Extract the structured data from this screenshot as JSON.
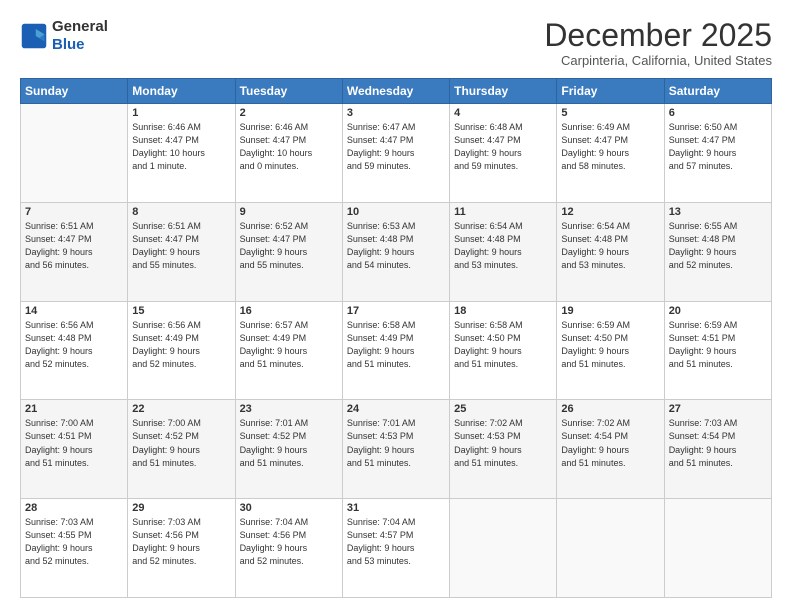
{
  "header": {
    "logo_line1": "General",
    "logo_line2": "Blue",
    "month": "December 2025",
    "location": "Carpinteria, California, United States"
  },
  "weekdays": [
    "Sunday",
    "Monday",
    "Tuesday",
    "Wednesday",
    "Thursday",
    "Friday",
    "Saturday"
  ],
  "weeks": [
    [
      {
        "day": "",
        "info": ""
      },
      {
        "day": "1",
        "info": "Sunrise: 6:46 AM\nSunset: 4:47 PM\nDaylight: 10 hours\nand 1 minute."
      },
      {
        "day": "2",
        "info": "Sunrise: 6:46 AM\nSunset: 4:47 PM\nDaylight: 10 hours\nand 0 minutes."
      },
      {
        "day": "3",
        "info": "Sunrise: 6:47 AM\nSunset: 4:47 PM\nDaylight: 9 hours\nand 59 minutes."
      },
      {
        "day": "4",
        "info": "Sunrise: 6:48 AM\nSunset: 4:47 PM\nDaylight: 9 hours\nand 59 minutes."
      },
      {
        "day": "5",
        "info": "Sunrise: 6:49 AM\nSunset: 4:47 PM\nDaylight: 9 hours\nand 58 minutes."
      },
      {
        "day": "6",
        "info": "Sunrise: 6:50 AM\nSunset: 4:47 PM\nDaylight: 9 hours\nand 57 minutes."
      }
    ],
    [
      {
        "day": "7",
        "info": "Sunrise: 6:51 AM\nSunset: 4:47 PM\nDaylight: 9 hours\nand 56 minutes."
      },
      {
        "day": "8",
        "info": "Sunrise: 6:51 AM\nSunset: 4:47 PM\nDaylight: 9 hours\nand 55 minutes."
      },
      {
        "day": "9",
        "info": "Sunrise: 6:52 AM\nSunset: 4:47 PM\nDaylight: 9 hours\nand 55 minutes."
      },
      {
        "day": "10",
        "info": "Sunrise: 6:53 AM\nSunset: 4:48 PM\nDaylight: 9 hours\nand 54 minutes."
      },
      {
        "day": "11",
        "info": "Sunrise: 6:54 AM\nSunset: 4:48 PM\nDaylight: 9 hours\nand 53 minutes."
      },
      {
        "day": "12",
        "info": "Sunrise: 6:54 AM\nSunset: 4:48 PM\nDaylight: 9 hours\nand 53 minutes."
      },
      {
        "day": "13",
        "info": "Sunrise: 6:55 AM\nSunset: 4:48 PM\nDaylight: 9 hours\nand 52 minutes."
      }
    ],
    [
      {
        "day": "14",
        "info": "Sunrise: 6:56 AM\nSunset: 4:48 PM\nDaylight: 9 hours\nand 52 minutes."
      },
      {
        "day": "15",
        "info": "Sunrise: 6:56 AM\nSunset: 4:49 PM\nDaylight: 9 hours\nand 52 minutes."
      },
      {
        "day": "16",
        "info": "Sunrise: 6:57 AM\nSunset: 4:49 PM\nDaylight: 9 hours\nand 51 minutes."
      },
      {
        "day": "17",
        "info": "Sunrise: 6:58 AM\nSunset: 4:49 PM\nDaylight: 9 hours\nand 51 minutes."
      },
      {
        "day": "18",
        "info": "Sunrise: 6:58 AM\nSunset: 4:50 PM\nDaylight: 9 hours\nand 51 minutes."
      },
      {
        "day": "19",
        "info": "Sunrise: 6:59 AM\nSunset: 4:50 PM\nDaylight: 9 hours\nand 51 minutes."
      },
      {
        "day": "20",
        "info": "Sunrise: 6:59 AM\nSunset: 4:51 PM\nDaylight: 9 hours\nand 51 minutes."
      }
    ],
    [
      {
        "day": "21",
        "info": "Sunrise: 7:00 AM\nSunset: 4:51 PM\nDaylight: 9 hours\nand 51 minutes."
      },
      {
        "day": "22",
        "info": "Sunrise: 7:00 AM\nSunset: 4:52 PM\nDaylight: 9 hours\nand 51 minutes."
      },
      {
        "day": "23",
        "info": "Sunrise: 7:01 AM\nSunset: 4:52 PM\nDaylight: 9 hours\nand 51 minutes."
      },
      {
        "day": "24",
        "info": "Sunrise: 7:01 AM\nSunset: 4:53 PM\nDaylight: 9 hours\nand 51 minutes."
      },
      {
        "day": "25",
        "info": "Sunrise: 7:02 AM\nSunset: 4:53 PM\nDaylight: 9 hours\nand 51 minutes."
      },
      {
        "day": "26",
        "info": "Sunrise: 7:02 AM\nSunset: 4:54 PM\nDaylight: 9 hours\nand 51 minutes."
      },
      {
        "day": "27",
        "info": "Sunrise: 7:03 AM\nSunset: 4:54 PM\nDaylight: 9 hours\nand 51 minutes."
      }
    ],
    [
      {
        "day": "28",
        "info": "Sunrise: 7:03 AM\nSunset: 4:55 PM\nDaylight: 9 hours\nand 52 minutes."
      },
      {
        "day": "29",
        "info": "Sunrise: 7:03 AM\nSunset: 4:56 PM\nDaylight: 9 hours\nand 52 minutes."
      },
      {
        "day": "30",
        "info": "Sunrise: 7:04 AM\nSunset: 4:56 PM\nDaylight: 9 hours\nand 52 minutes."
      },
      {
        "day": "31",
        "info": "Sunrise: 7:04 AM\nSunset: 4:57 PM\nDaylight: 9 hours\nand 53 minutes."
      },
      {
        "day": "",
        "info": ""
      },
      {
        "day": "",
        "info": ""
      },
      {
        "day": "",
        "info": ""
      }
    ]
  ]
}
